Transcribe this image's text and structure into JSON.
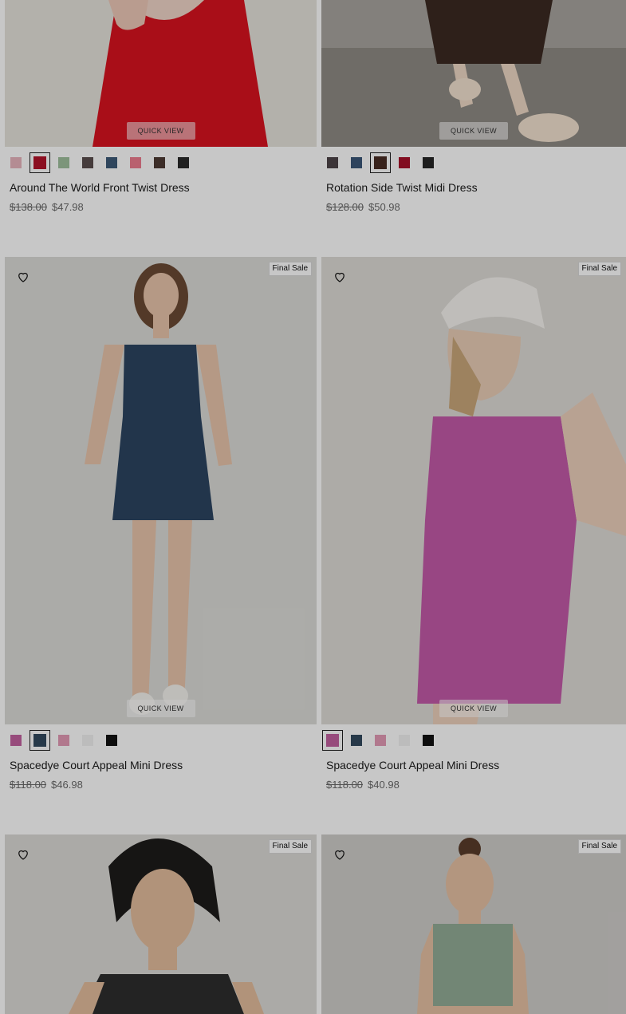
{
  "products": [
    {
      "name": "Around The World Front Twist Dress",
      "original_price": "$138.00",
      "sale_price": "$47.98",
      "quick_view": "QUICK VIEW",
      "badge": "",
      "swatches": [
        "#e7b4bd",
        "#b3132a",
        "#9fbf9d",
        "#5a4d4d",
        "#3d5a78",
        "#ee7d8f",
        "#4e3a34",
        "#2a2a2a"
      ],
      "selected": 1,
      "photo_colors": [
        "#e6e3dc",
        "#d9131f"
      ]
    },
    {
      "name": "Rotation Side Twist Midi Dress",
      "original_price": "$128.00",
      "sale_price": "$50.98",
      "quick_view": "QUICK VIEW",
      "badge": "",
      "swatches": [
        "#4d4548",
        "#3a5678",
        "#4a2e25",
        "#a7112a",
        "#262626"
      ],
      "selected": 2,
      "photo_colors": [
        "#9b968e",
        "#3b2a22"
      ]
    },
    {
      "name": "Spacedye Court Appeal Mini Dress",
      "original_price": "$118.00",
      "sale_price": "$46.98",
      "quick_view": "QUICK VIEW",
      "badge": "Final Sale",
      "swatches": [
        "#c2609f",
        "#324a5e",
        "#e39ab5",
        "#f1f1f1",
        "#111111"
      ],
      "selected": 1,
      "photo_colors": [
        "#d9d9d6",
        "#2c4560"
      ]
    },
    {
      "name": "Spacedye Court Appeal Mini Dress",
      "original_price": "$118.00",
      "sale_price": "$40.98",
      "quick_view": "QUICK VIEW",
      "badge": "Final Sale",
      "swatches": [
        "#c2609f",
        "#324a5e",
        "#e39ab5",
        "#f1f1f1",
        "#111111"
      ],
      "selected": 0,
      "photo_colors": [
        "#d9d9d6",
        "#c35aa8"
      ]
    },
    {
      "name": "",
      "original_price": "",
      "sale_price": "",
      "quick_view": "",
      "badge": "Final Sale",
      "swatches": [],
      "selected": -1,
      "photo_colors": [
        "#dcdad6",
        "#2e2e2e"
      ]
    },
    {
      "name": "",
      "original_price": "",
      "sale_price": "",
      "quick_view": "",
      "badge": "Final Sale",
      "swatches": [],
      "selected": -1,
      "photo_colors": [
        "#cfcdca",
        "#93ac96"
      ]
    }
  ]
}
